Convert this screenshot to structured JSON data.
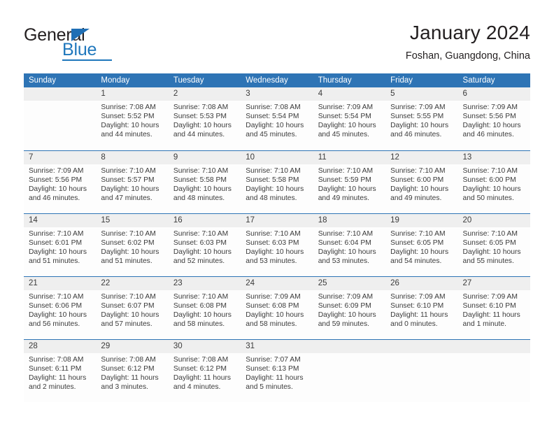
{
  "brand": {
    "name_part1": "General",
    "name_part2": "Blue",
    "triangle_color": "#1f6fb5",
    "blue_color": "#1f77bc",
    "dark_color": "#231f20"
  },
  "header": {
    "title": "January 2024",
    "subtitle": "Foshan, Guangdong, China"
  },
  "theme": {
    "header_blue": "#2e74b5",
    "daynum_gray": "#efefef",
    "cell_white": "#fdfdfd",
    "text_dark": "#3b3b3b"
  },
  "weekdays": [
    "Sunday",
    "Monday",
    "Tuesday",
    "Wednesday",
    "Thursday",
    "Friday",
    "Saturday"
  ],
  "weeks": [
    [
      {
        "day": "",
        "sunrise": "",
        "sunset": "",
        "daylight_line1": "",
        "daylight_line2": ""
      },
      {
        "day": "1",
        "sunrise": "Sunrise: 7:08 AM",
        "sunset": "Sunset: 5:52 PM",
        "daylight_line1": "Daylight: 10 hours",
        "daylight_line2": "and 44 minutes."
      },
      {
        "day": "2",
        "sunrise": "Sunrise: 7:08 AM",
        "sunset": "Sunset: 5:53 PM",
        "daylight_line1": "Daylight: 10 hours",
        "daylight_line2": "and 44 minutes."
      },
      {
        "day": "3",
        "sunrise": "Sunrise: 7:08 AM",
        "sunset": "Sunset: 5:54 PM",
        "daylight_line1": "Daylight: 10 hours",
        "daylight_line2": "and 45 minutes."
      },
      {
        "day": "4",
        "sunrise": "Sunrise: 7:09 AM",
        "sunset": "Sunset: 5:54 PM",
        "daylight_line1": "Daylight: 10 hours",
        "daylight_line2": "and 45 minutes."
      },
      {
        "day": "5",
        "sunrise": "Sunrise: 7:09 AM",
        "sunset": "Sunset: 5:55 PM",
        "daylight_line1": "Daylight: 10 hours",
        "daylight_line2": "and 46 minutes."
      },
      {
        "day": "6",
        "sunrise": "Sunrise: 7:09 AM",
        "sunset": "Sunset: 5:56 PM",
        "daylight_line1": "Daylight: 10 hours",
        "daylight_line2": "and 46 minutes."
      }
    ],
    [
      {
        "day": "7",
        "sunrise": "Sunrise: 7:09 AM",
        "sunset": "Sunset: 5:56 PM",
        "daylight_line1": "Daylight: 10 hours",
        "daylight_line2": "and 46 minutes."
      },
      {
        "day": "8",
        "sunrise": "Sunrise: 7:10 AM",
        "sunset": "Sunset: 5:57 PM",
        "daylight_line1": "Daylight: 10 hours",
        "daylight_line2": "and 47 minutes."
      },
      {
        "day": "9",
        "sunrise": "Sunrise: 7:10 AM",
        "sunset": "Sunset: 5:58 PM",
        "daylight_line1": "Daylight: 10 hours",
        "daylight_line2": "and 48 minutes."
      },
      {
        "day": "10",
        "sunrise": "Sunrise: 7:10 AM",
        "sunset": "Sunset: 5:58 PM",
        "daylight_line1": "Daylight: 10 hours",
        "daylight_line2": "and 48 minutes."
      },
      {
        "day": "11",
        "sunrise": "Sunrise: 7:10 AM",
        "sunset": "Sunset: 5:59 PM",
        "daylight_line1": "Daylight: 10 hours",
        "daylight_line2": "and 49 minutes."
      },
      {
        "day": "12",
        "sunrise": "Sunrise: 7:10 AM",
        "sunset": "Sunset: 6:00 PM",
        "daylight_line1": "Daylight: 10 hours",
        "daylight_line2": "and 49 minutes."
      },
      {
        "day": "13",
        "sunrise": "Sunrise: 7:10 AM",
        "sunset": "Sunset: 6:00 PM",
        "daylight_line1": "Daylight: 10 hours",
        "daylight_line2": "and 50 minutes."
      }
    ],
    [
      {
        "day": "14",
        "sunrise": "Sunrise: 7:10 AM",
        "sunset": "Sunset: 6:01 PM",
        "daylight_line1": "Daylight: 10 hours",
        "daylight_line2": "and 51 minutes."
      },
      {
        "day": "15",
        "sunrise": "Sunrise: 7:10 AM",
        "sunset": "Sunset: 6:02 PM",
        "daylight_line1": "Daylight: 10 hours",
        "daylight_line2": "and 51 minutes."
      },
      {
        "day": "16",
        "sunrise": "Sunrise: 7:10 AM",
        "sunset": "Sunset: 6:03 PM",
        "daylight_line1": "Daylight: 10 hours",
        "daylight_line2": "and 52 minutes."
      },
      {
        "day": "17",
        "sunrise": "Sunrise: 7:10 AM",
        "sunset": "Sunset: 6:03 PM",
        "daylight_line1": "Daylight: 10 hours",
        "daylight_line2": "and 53 minutes."
      },
      {
        "day": "18",
        "sunrise": "Sunrise: 7:10 AM",
        "sunset": "Sunset: 6:04 PM",
        "daylight_line1": "Daylight: 10 hours",
        "daylight_line2": "and 53 minutes."
      },
      {
        "day": "19",
        "sunrise": "Sunrise: 7:10 AM",
        "sunset": "Sunset: 6:05 PM",
        "daylight_line1": "Daylight: 10 hours",
        "daylight_line2": "and 54 minutes."
      },
      {
        "day": "20",
        "sunrise": "Sunrise: 7:10 AM",
        "sunset": "Sunset: 6:05 PM",
        "daylight_line1": "Daylight: 10 hours",
        "daylight_line2": "and 55 minutes."
      }
    ],
    [
      {
        "day": "21",
        "sunrise": "Sunrise: 7:10 AM",
        "sunset": "Sunset: 6:06 PM",
        "daylight_line1": "Daylight: 10 hours",
        "daylight_line2": "and 56 minutes."
      },
      {
        "day": "22",
        "sunrise": "Sunrise: 7:10 AM",
        "sunset": "Sunset: 6:07 PM",
        "daylight_line1": "Daylight: 10 hours",
        "daylight_line2": "and 57 minutes."
      },
      {
        "day": "23",
        "sunrise": "Sunrise: 7:10 AM",
        "sunset": "Sunset: 6:08 PM",
        "daylight_line1": "Daylight: 10 hours",
        "daylight_line2": "and 58 minutes."
      },
      {
        "day": "24",
        "sunrise": "Sunrise: 7:09 AM",
        "sunset": "Sunset: 6:08 PM",
        "daylight_line1": "Daylight: 10 hours",
        "daylight_line2": "and 58 minutes."
      },
      {
        "day": "25",
        "sunrise": "Sunrise: 7:09 AM",
        "sunset": "Sunset: 6:09 PM",
        "daylight_line1": "Daylight: 10 hours",
        "daylight_line2": "and 59 minutes."
      },
      {
        "day": "26",
        "sunrise": "Sunrise: 7:09 AM",
        "sunset": "Sunset: 6:10 PM",
        "daylight_line1": "Daylight: 11 hours",
        "daylight_line2": "and 0 minutes."
      },
      {
        "day": "27",
        "sunrise": "Sunrise: 7:09 AM",
        "sunset": "Sunset: 6:10 PM",
        "daylight_line1": "Daylight: 11 hours",
        "daylight_line2": "and 1 minute."
      }
    ],
    [
      {
        "day": "28",
        "sunrise": "Sunrise: 7:08 AM",
        "sunset": "Sunset: 6:11 PM",
        "daylight_line1": "Daylight: 11 hours",
        "daylight_line2": "and 2 minutes."
      },
      {
        "day": "29",
        "sunrise": "Sunrise: 7:08 AM",
        "sunset": "Sunset: 6:12 PM",
        "daylight_line1": "Daylight: 11 hours",
        "daylight_line2": "and 3 minutes."
      },
      {
        "day": "30",
        "sunrise": "Sunrise: 7:08 AM",
        "sunset": "Sunset: 6:12 PM",
        "daylight_line1": "Daylight: 11 hours",
        "daylight_line2": "and 4 minutes."
      },
      {
        "day": "31",
        "sunrise": "Sunrise: 7:07 AM",
        "sunset": "Sunset: 6:13 PM",
        "daylight_line1": "Daylight: 11 hours",
        "daylight_line2": "and 5 minutes."
      },
      {
        "day": "",
        "sunrise": "",
        "sunset": "",
        "daylight_line1": "",
        "daylight_line2": ""
      },
      {
        "day": "",
        "sunrise": "",
        "sunset": "",
        "daylight_line1": "",
        "daylight_line2": ""
      },
      {
        "day": "",
        "sunrise": "",
        "sunset": "",
        "daylight_line1": "",
        "daylight_line2": ""
      }
    ]
  ]
}
